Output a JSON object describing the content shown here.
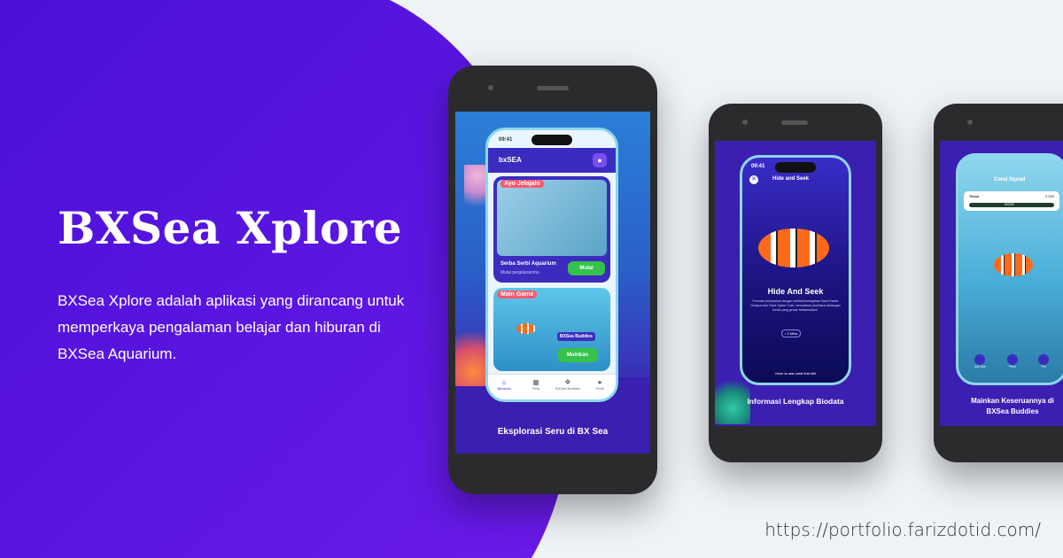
{
  "hero": {
    "title": "BXSea Xplore",
    "description": "BXSea Xplore adalah aplikasi yang dirancang untuk memperkaya pengalaman belajar dan hiburan di BXSea Aquarium."
  },
  "footer": {
    "url": "https://portfolio.farizdotid.com/"
  },
  "colors": {
    "purple_bg": "#5b14e6",
    "screen_bg": "#3a1fb0",
    "green_button": "#34c24a",
    "tag_red": "#ff5a6e"
  },
  "phone1": {
    "caption": "Eksplorasi Seru di BX Sea",
    "status_time": "09:41",
    "app_logo": "bxSEA",
    "section1_tag": "Ayo Jelajahi",
    "card_title": "Serba Serbi Aquarium",
    "card_subtitle": "Mulai perjalananmu",
    "start_button": "Mulai",
    "section2_tag": "Main Game",
    "buddies_label": "BXSea Buddies",
    "play_button": "Mainkan",
    "nav": [
      "Beranda",
      "Peta",
      "BXSea Buddies",
      "Profil"
    ]
  },
  "phone2": {
    "caption": "Informasi Lengkap Biodata",
    "status_time": "09:41",
    "header": "Hide and Seek",
    "fish_title": "Hide And Seek",
    "fish_desc": "Pemular peluasahan dengan melihat kemegahan Giant Pacific Octopus dan Giant Spider Crab, menuaskan prosfosus tantangan ikonis yang gemar berkamuflase.",
    "time_chip": "• 3 Mins",
    "footer_text": "Geser ke atas untuk lihat detil"
  },
  "phone3": {
    "caption": "Mainkan Keseruannya di BXSea Buddies",
    "header": "Coral Squad",
    "player_name": "Teeso",
    "coins": "2.000",
    "progress": "80/500",
    "actions": [
      "Call Dan",
      "Feed",
      "Pet"
    ]
  }
}
